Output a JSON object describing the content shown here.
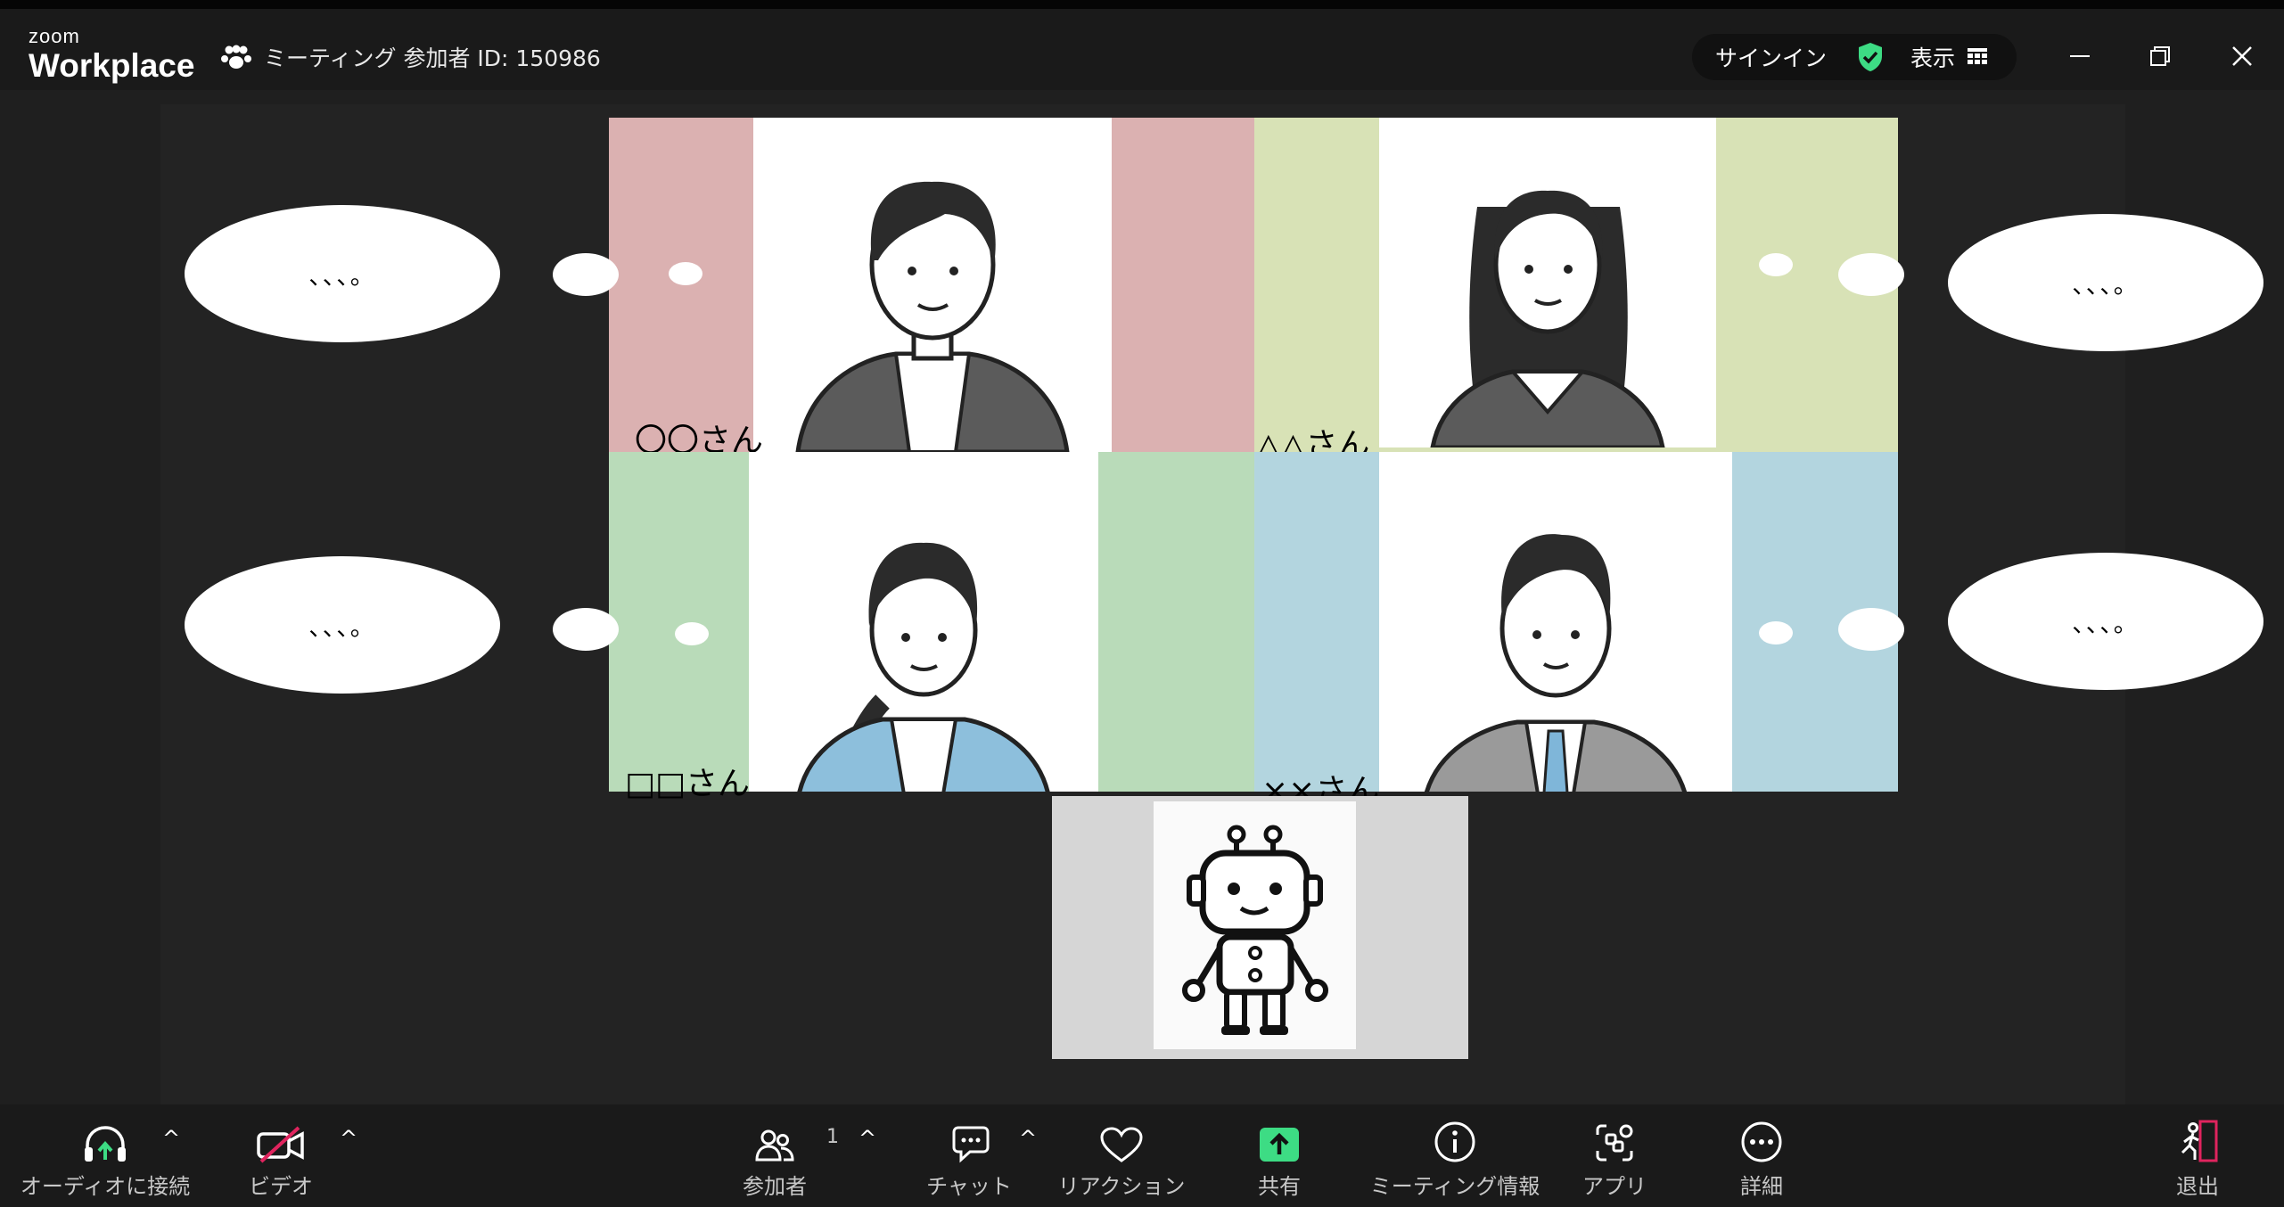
{
  "app": {
    "brand_small": "zoom",
    "brand_big": "Workplace"
  },
  "titlebar": {
    "meeting_title": "ミーティング 参加者 ID: 150986",
    "signin_label": "サインイン",
    "view_label": "表示"
  },
  "participants": [
    {
      "name": "〇〇さん",
      "bubble_text": "、、、。",
      "color": "#dbb1b1"
    },
    {
      "name": "△△さん",
      "bubble_text": "、、、。",
      "color": "#d8e2b6"
    },
    {
      "name": "□□さん",
      "bubble_text": "、、、。",
      "color": "#b9dbb9"
    },
    {
      "name": "××さん",
      "bubble_text": "、、、。",
      "color": "#b3d5df"
    }
  ],
  "toolbar": {
    "audio_label": "オーディオに接続",
    "video_label": "ビデオ",
    "participants_label": "参加者",
    "participants_count": "1",
    "chat_label": "チャット",
    "reaction_label": "リアクション",
    "share_label": "共有",
    "meeting_info_label": "ミーティング情報",
    "apps_label": "アプリ",
    "more_label": "詳細",
    "leave_label": "退出",
    "caret_glyph": "^"
  },
  "colors": {
    "accent_green": "#3ddc84",
    "leave_red": "#e0245e",
    "stage_bg": "#232323",
    "robot_tile_bg": "#d6d6d6"
  }
}
